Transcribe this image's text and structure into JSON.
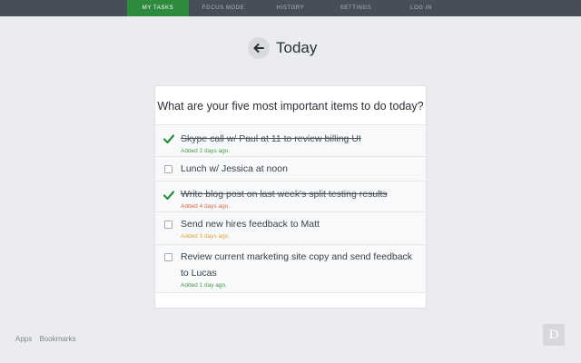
{
  "nav": {
    "items": [
      {
        "label": "MY TASKS",
        "active": true
      },
      {
        "label": "FOCUS MODE",
        "active": false
      },
      {
        "label": "HISTORY",
        "active": false
      },
      {
        "label": "SETTINGS",
        "active": false
      },
      {
        "label": "LOG IN",
        "active": false
      }
    ]
  },
  "header": {
    "back_icon": "arrow-left-icon",
    "title": "Today"
  },
  "card": {
    "title": "What are your five most important items to do today?",
    "items": [
      {
        "text": "Skype call w/ Paul at 11 to review billing UI",
        "done": true,
        "meta": "Added 2 days ago.",
        "meta_color": "#4a9a4a"
      },
      {
        "text": "Lunch w/ Jessica at noon",
        "done": false,
        "meta": "",
        "meta_color": ""
      },
      {
        "text": "Write blog post on last week's split testing results",
        "done": true,
        "meta": "Added 4 days ago.",
        "meta_color": "#d6694a"
      },
      {
        "text": "Send new hires feedback to Matt",
        "done": false,
        "meta": "Added 3 days ago.",
        "meta_color": "#e0a33a"
      },
      {
        "text": "Review current marketing site copy and send feedback to Lucas",
        "done": false,
        "meta": "Added 1 day ago.",
        "meta_color": "#4a9a4a"
      }
    ]
  },
  "footer": {
    "links": [
      "Apps",
      "Bookmarks"
    ],
    "logo_letter": "D"
  },
  "colors": {
    "accent": "#2e8b3e",
    "nav_bg": "#464f57",
    "page_bg": "#ebecef"
  }
}
